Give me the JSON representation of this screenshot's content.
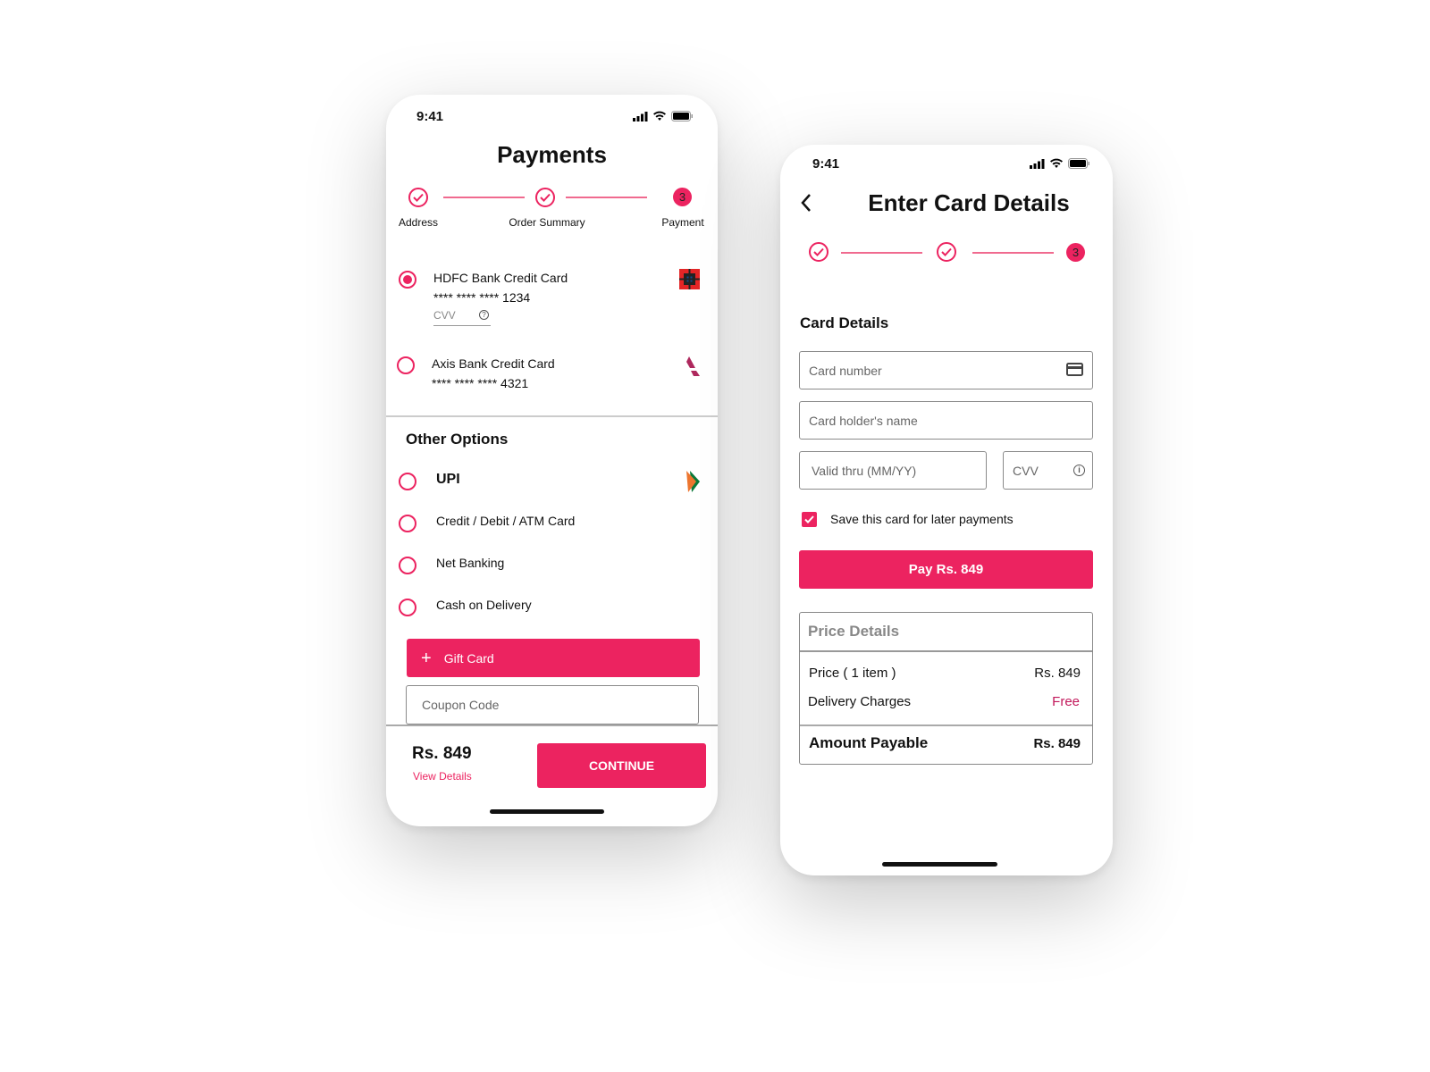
{
  "colors": {
    "accent": "#ec2360",
    "free": "#c2185b"
  },
  "payments": {
    "status_time": "9:41",
    "title": "Payments",
    "steps": [
      {
        "label": "Address",
        "state": "done"
      },
      {
        "label": "Order Summary",
        "state": "done"
      },
      {
        "label": "Payment",
        "state": "current",
        "number": "3"
      }
    ],
    "saved_cards": [
      {
        "name": "HDFC Bank Credit Card",
        "number": "**** **** **** 1234",
        "selected": true,
        "cvv_placeholder": "CVV",
        "logo": "hdfc-logo"
      },
      {
        "name": "Axis Bank Credit Card",
        "number": "**** **** **** 4321",
        "selected": false,
        "logo": "axis-logo"
      }
    ],
    "other_options_title": "Other Options",
    "other_options": [
      {
        "label": "UPI",
        "logo": "upi-logo"
      },
      {
        "label": "Credit / Debit / ATM Card"
      },
      {
        "label": "Net Banking"
      },
      {
        "label": "Cash on Delivery"
      }
    ],
    "gift_card_label": "Gift Card",
    "coupon_placeholder": "Coupon Code",
    "footer": {
      "total": "Rs. 849",
      "view_details": "View Details",
      "continue": "CONTINUE"
    }
  },
  "card_details": {
    "status_time": "9:41",
    "title": "Enter Card Details",
    "step_number": "3",
    "section_title": "Card Details",
    "card_number_placeholder": "Card number",
    "holder_placeholder": "Card holder's name",
    "valid_placeholder": "Valid thru (MM/YY)",
    "cvv_placeholder": "CVV",
    "save_card_label": "Save this card for later payments",
    "save_card_checked": true,
    "pay_button": "Pay Rs. 849",
    "price_details": {
      "title": "Price Details",
      "rows": [
        {
          "label": "Price ( 1 item )",
          "value": "Rs. 849"
        },
        {
          "label": "Delivery Charges",
          "value": "Free"
        }
      ],
      "total_label": "Amount Payable",
      "total_value": "Rs. 849"
    }
  }
}
